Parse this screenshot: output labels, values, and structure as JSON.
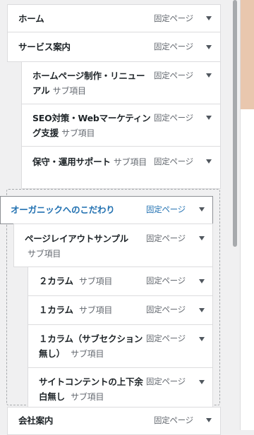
{
  "menu": {
    "items": [
      {
        "title": "ホーム",
        "subtitle": "",
        "type": "固定ページ"
      },
      {
        "title": "サービス案内",
        "subtitle": "",
        "type": "固定ページ"
      },
      {
        "title": "ホームページ制作・リニューアル",
        "subtitle": "サブ項目",
        "type": "固定ページ"
      },
      {
        "title": "SEO対策・Webマーケティング支援",
        "subtitle": "サブ項目",
        "type": "固定ページ"
      },
      {
        "title": "保守・運用サポート",
        "subtitle": "サブ項目",
        "type": "固定ページ"
      },
      {
        "title": "オーガニックへのこだわり",
        "subtitle": "",
        "type": "固定ページ"
      },
      {
        "title": "ページレイアウトサンプル",
        "subtitle": "サブ項目",
        "type": "固定ページ"
      },
      {
        "title": "２カラム",
        "subtitle": "サブ項目",
        "type": "固定ページ"
      },
      {
        "title": "１カラム",
        "subtitle": "サブ項目",
        "type": "固定ページ"
      },
      {
        "title": "１カラム（サブセクション無し）",
        "subtitle": "サブ項目",
        "type": "固定ページ"
      },
      {
        "title": "サイトコンテントの上下余白無し",
        "subtitle": "サブ項目",
        "type": "固定ページ"
      },
      {
        "title": "会社案内",
        "subtitle": "",
        "type": "固定ページ"
      }
    ]
  },
  "colors": {
    "active_text": "#2271b1",
    "arrow": "#50575e",
    "border": "#dcdcde"
  }
}
